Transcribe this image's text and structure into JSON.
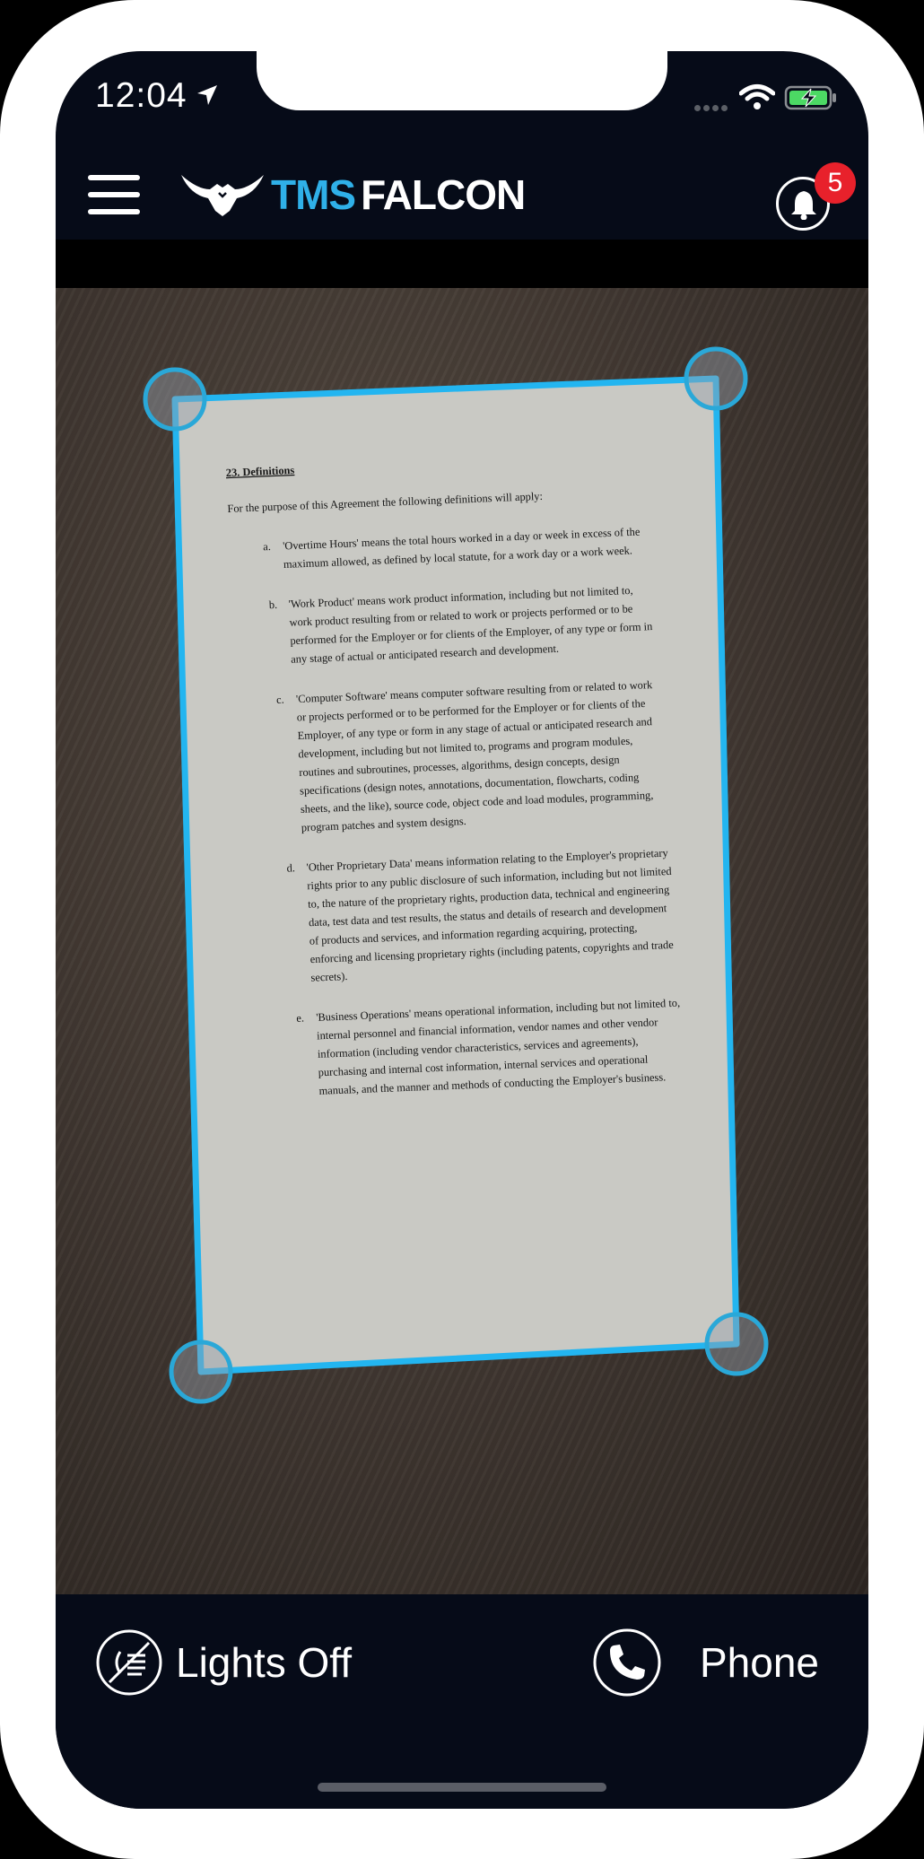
{
  "status_bar": {
    "time": "12:04"
  },
  "header": {
    "brand_primary": "TMS",
    "brand_secondary": "FALCON",
    "notification_count": "5"
  },
  "document": {
    "heading": "23. Definitions",
    "intro": "For the purpose of this Agreement the following definitions will apply:",
    "items": [
      {
        "marker": "a.",
        "lines": [
          "'Overtime Hours' means the total hours worked in a day or week in excess of the",
          "maximum allowed, as defined by local statute, for a work day or a work week."
        ]
      },
      {
        "marker": "b.",
        "lines": [
          "'Work Product' means work product information, including but not limited to,",
          "work product resulting from or related to work or projects performed or to be",
          "performed for the Employer or for clients of the Employer, of any type or form in",
          "any stage of actual or anticipated research and development."
        ]
      },
      {
        "marker": "c.",
        "lines": [
          "'Computer Software' means computer software resulting from or related to work",
          "or projects performed or to be performed for the Employer or for clients of the",
          "Employer, of any type or form in any stage of actual or anticipated research and",
          "development, including but not limited to, programs and program modules,",
          "routines and subroutines, processes, algorithms, design concepts, design",
          "specifications (design notes, annotations, documentation, flowcharts, coding",
          "sheets, and the like), source code, object code and load modules, programming,",
          "program patches and system designs."
        ]
      },
      {
        "marker": "d.",
        "lines": [
          "'Other Proprietary Data' means information relating to the Employer's proprietary",
          "rights prior to any public disclosure of such information, including but not limited",
          "to, the nature of the proprietary rights, production data, technical and engineering",
          "data, test data and test results, the status and details of research and development",
          "of products and services, and information regarding acquiring, protecting,",
          "enforcing and licensing proprietary rights (including patents, copyrights and trade",
          "secrets)."
        ]
      },
      {
        "marker": "e.",
        "lines": [
          "'Business Operations' means operational information, including but not limited to,",
          "internal personnel and financial information, vendor names and other vendor",
          "information (including vendor characteristics, services and agreements),",
          "purchasing and internal cost information, internal services and operational",
          "manuals, and the manner and methods of conducting the Employer's business."
        ]
      }
    ]
  },
  "bottom_bar": {
    "lights_label": "Lights Off",
    "phone_label": "Phone"
  },
  "icons": {
    "menu": "hamburger-menu-icon",
    "bell": "bell-icon",
    "lights": "lights-off-icon",
    "phone": "phone-icon",
    "logo": "falcon-logo-icon"
  },
  "colors": {
    "app_background": "#060b18",
    "brand_blue": "#2fb0e8",
    "crop_frame": "#23b5f0",
    "badge_red": "#e8212b",
    "paper": "#c9c9c4"
  }
}
